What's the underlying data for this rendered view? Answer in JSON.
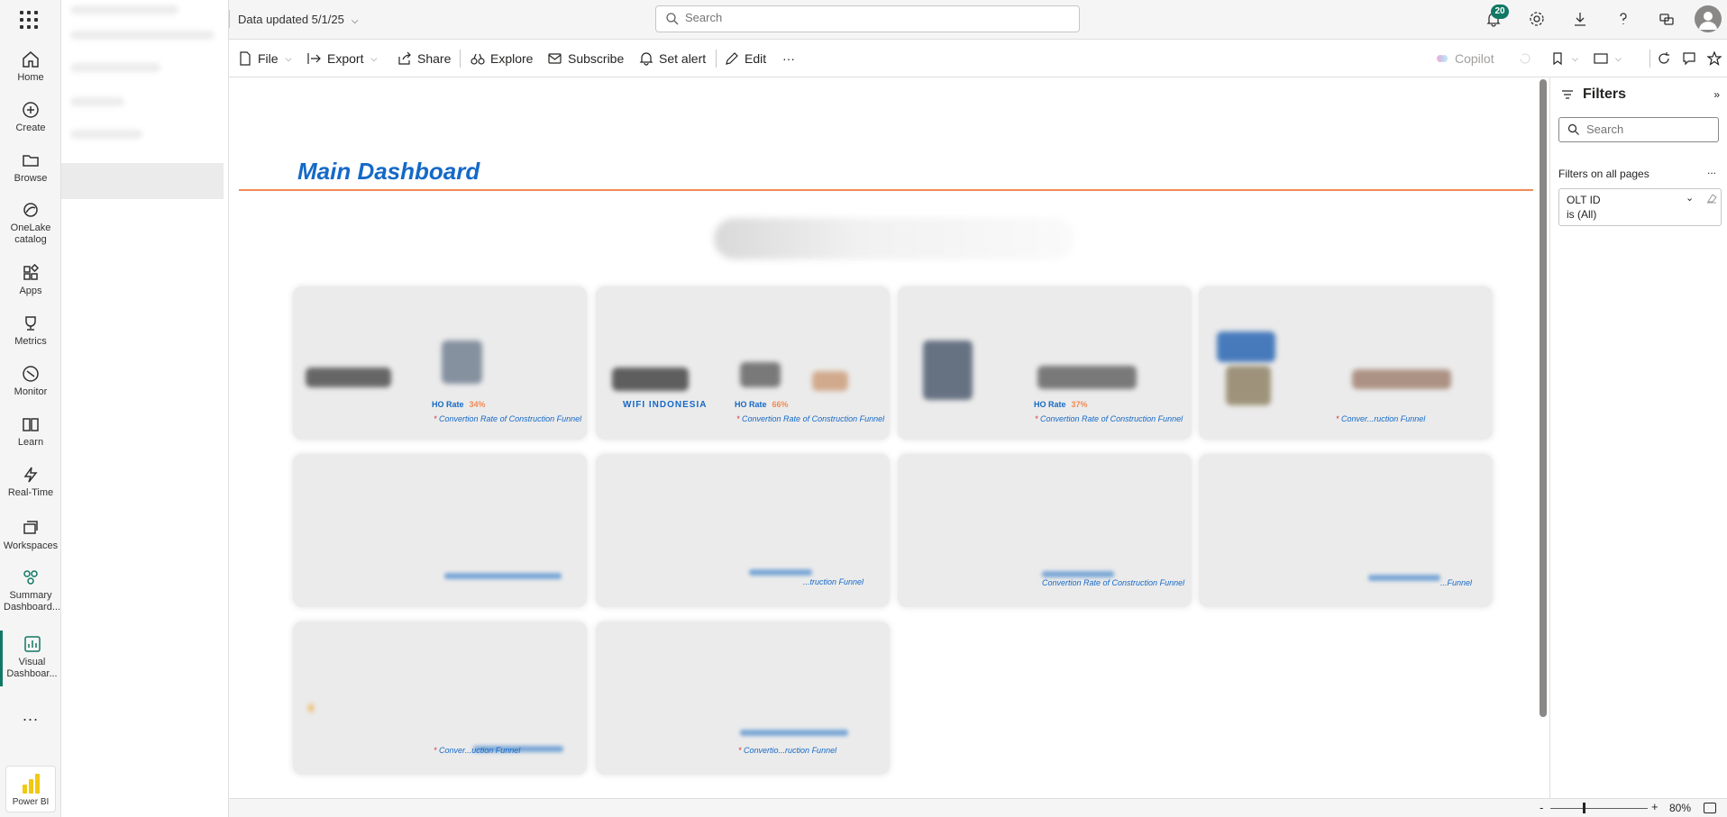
{
  "nav": {
    "items": [
      {
        "label": "Home",
        "icon": "home-icon"
      },
      {
        "label": "Create",
        "icon": "plus-circle-icon"
      },
      {
        "label": "Browse",
        "icon": "folder-icon"
      },
      {
        "label": "OneLake catalog",
        "icon": "onelake-icon"
      },
      {
        "label": "Apps",
        "icon": "apps-icon"
      },
      {
        "label": "Metrics",
        "icon": "trophy-icon"
      },
      {
        "label": "Monitor",
        "icon": "monitor-icon"
      },
      {
        "label": "Learn",
        "icon": "book-icon"
      },
      {
        "label": "Real-Time",
        "icon": "lightning-icon"
      },
      {
        "label": "Workspaces",
        "icon": "workspaces-icon"
      },
      {
        "label": "Summary Dashboard...",
        "icon": "summary-dashboard-icon"
      },
      {
        "label": "Visual Dashboar...",
        "icon": "report-icon",
        "active": true
      }
    ],
    "more": "...",
    "product": "Power BI"
  },
  "topbar": {
    "data_updated": "Data updated 5/1/25",
    "search_placeholder": "Search",
    "notification_count": "20"
  },
  "ribbon": {
    "file": "File",
    "export": "Export",
    "share": "Share",
    "explore": "Explore",
    "subscribe": "Subscribe",
    "set_alert": "Set alert",
    "edit": "Edit",
    "more": "···",
    "copilot": "Copilot"
  },
  "report": {
    "title": "Main Dashboard",
    "cards": [
      {
        "brand": "",
        "ho_label": "HO Rate",
        "ho_value": "34%",
        "note": "Convertion Rate of Construction Funnel"
      },
      {
        "brand": "WIFI INDONESIA",
        "ho_label": "HO Rate",
        "ho_value": "66%",
        "note": "Convertion Rate of Construction Funnel"
      },
      {
        "brand": "",
        "ho_label": "HO Rate",
        "ho_value": "37%",
        "note": "Convertion Rate of Construction Funnel"
      },
      {
        "brand": "",
        "ho_label": "",
        "ho_value": "",
        "note": "Conver...ruction Funnel"
      },
      {
        "note": ""
      },
      {
        "note": "...truction Funnel"
      },
      {
        "note": "Convertion Rate of Construction Funnel"
      },
      {
        "note": "...Funnel"
      },
      {
        "note": "Conver...uction Funnel"
      },
      {
        "note": "Convertio...ruction Funnel"
      }
    ]
  },
  "filters": {
    "title": "Filters",
    "search_placeholder": "Search",
    "section": "Filters on all pages",
    "more": "...",
    "card": {
      "name": "OLT ID",
      "value": "is (All)"
    }
  },
  "status": {
    "zoom": "80%"
  },
  "colors": {
    "accent": "#117865",
    "title_blue": "#1569c7",
    "rule_orange": "#f28a55",
    "card_bg": "#ebebeb"
  }
}
